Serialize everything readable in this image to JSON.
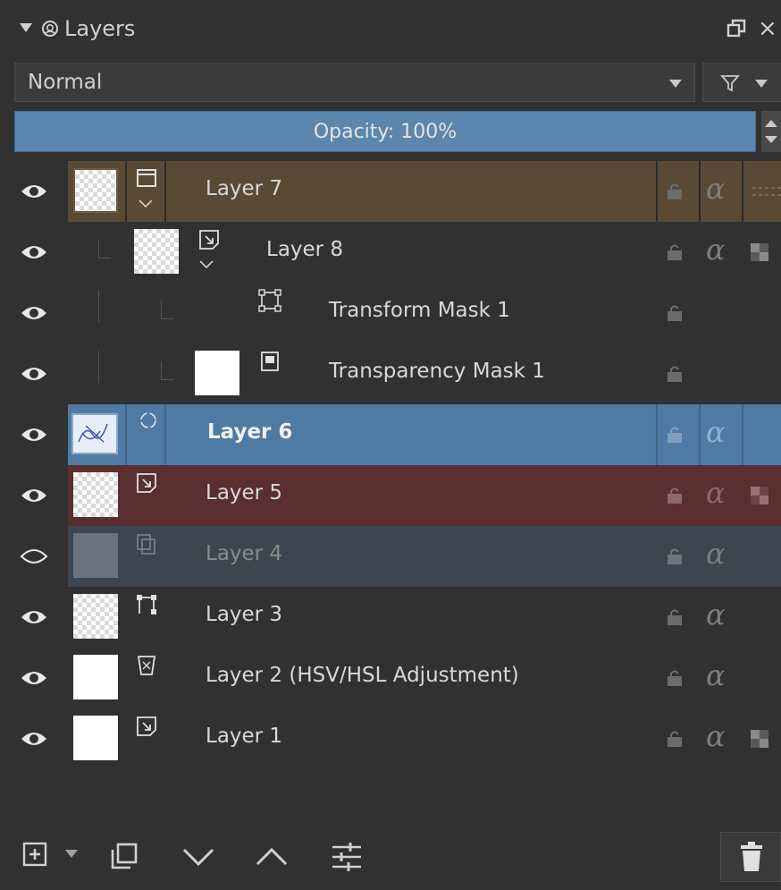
{
  "panel": {
    "title": "Layers",
    "blend_mode": "Normal",
    "opacity_label": "Opacity:",
    "opacity_value": "100%",
    "opacity_fraction": 1.0
  },
  "layers": [
    {
      "name": "Layer 7",
      "type": "group-icon",
      "visible": true,
      "style": "group"
    },
    {
      "name": "Layer 8",
      "type": "paint-layer-icon",
      "visible": true,
      "style": "child"
    },
    {
      "name": "Transform Mask 1",
      "type": "transform-mask-icon",
      "visible": true,
      "style": "mask"
    },
    {
      "name": "Transparency Mask 1",
      "type": "transparency-mask-icon",
      "visible": true,
      "style": "mask"
    },
    {
      "name": "Layer 6",
      "type": "filter-layer-icon",
      "visible": true,
      "style": "selected"
    },
    {
      "name": "Layer 5",
      "type": "paint-layer-icon",
      "visible": true,
      "style": "red"
    },
    {
      "name": "Layer 4",
      "type": "clone-layer-icon",
      "visible": false,
      "style": "hidden"
    },
    {
      "name": "Layer 3",
      "type": "vector-layer-icon",
      "visible": true,
      "style": "normal"
    },
    {
      "name": "Layer 2 (HSV/HSL Adjustment)",
      "type": "adjustment-layer-icon",
      "visible": true,
      "style": "normal"
    },
    {
      "name": "Layer 1",
      "type": "paint-layer-icon",
      "visible": true,
      "style": "normal"
    }
  ],
  "colors": {
    "background": "#313131",
    "group_row": "#5a4a35",
    "selected_row": "#4f7aa3",
    "red_row": "#5a2f2f",
    "hidden_row": "#3c4650",
    "opacity_fill": "#5b86ad"
  }
}
